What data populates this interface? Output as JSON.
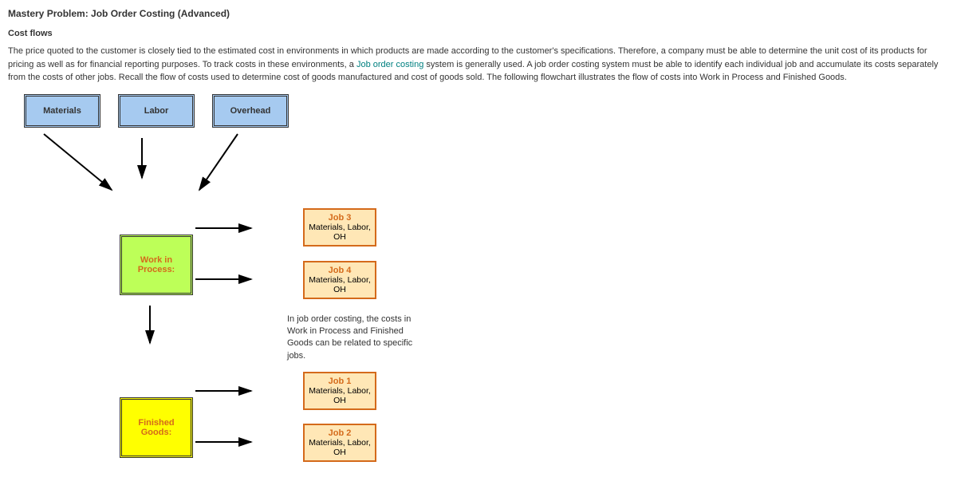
{
  "title": "Mastery Problem: Job Order Costing (Advanced)",
  "subtitle": "Cost flows",
  "para_before_link": "The price quoted to the customer is closely tied to the estimated cost in environments in which products are made according to the customer's specifications. Therefore, a company must be able to determine the unit cost of its products for pricing as well as for financial reporting purposes. To track costs in these environments, a ",
  "link_text": "Job order costing",
  "para_after_link": " system is generally used. A job order costing system must be able to identify each individual job and accumulate its costs separately from the costs of other jobs. Recall the flow of costs used to determine cost of goods manufactured and cost of goods sold. The following flowchart illustrates the flow of costs into Work in Process and Finished Goods.",
  "boxes": {
    "materials": "Materials",
    "labor": "Labor",
    "overhead": "Overhead",
    "wip_line1": "Work in",
    "wip_line2": "Process:",
    "finished_line1": "Finished",
    "finished_line2": "Goods:"
  },
  "jobs": {
    "job3_title": "Job 3",
    "job4_title": "Job 4",
    "job1_title": "Job 1",
    "job2_title": "Job 2",
    "sub_line1": "Materials, Labor,",
    "sub_line2": "OH"
  },
  "note": "In job order costing, the costs in Work in Process and Finished Goods can be related to specific jobs."
}
